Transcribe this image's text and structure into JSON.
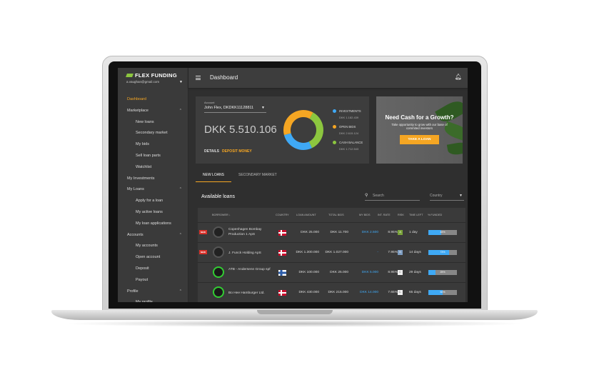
{
  "brand": "FLEX FUNDING",
  "user_email": "a.vaughan@gmail.com",
  "header": {
    "title": "Dashboard"
  },
  "sidebar": [
    {
      "label": "Dashboard",
      "level": 0,
      "active": true
    },
    {
      "label": "Marketplace",
      "level": 0,
      "expandable": true
    },
    {
      "label": "New loans",
      "level": 1
    },
    {
      "label": "Secondary market",
      "level": 1
    },
    {
      "label": "My bids",
      "level": 1
    },
    {
      "label": "Sell loan parts",
      "level": 1
    },
    {
      "label": "Watchlist",
      "level": 1
    },
    {
      "label": "My Investments",
      "level": 0
    },
    {
      "label": "My Loans",
      "level": 0,
      "expandable": true
    },
    {
      "label": "Apply for a loan",
      "level": 1
    },
    {
      "label": "My active loans",
      "level": 1
    },
    {
      "label": "My loan applications",
      "level": 1
    },
    {
      "label": "Accounts",
      "level": 0,
      "expandable": true
    },
    {
      "label": "My accounts",
      "level": 1
    },
    {
      "label": "Open account",
      "level": 1
    },
    {
      "label": "Deposit",
      "level": 1
    },
    {
      "label": "Payout",
      "level": 1
    },
    {
      "label": "Profile",
      "level": 0,
      "expandable": true
    },
    {
      "label": "My profile",
      "level": 1
    }
  ],
  "account": {
    "label": "Account",
    "selected": "John Flex, DKDKK11128811",
    "balance": "DKK 5.510.106",
    "details": "DETAILS",
    "deposit": "DEPOSIT MONEY",
    "legend": [
      {
        "label": "INVESTMENTS",
        "value": "DKK 1.182.439",
        "color": "#3fa9f5",
        "share": 0.28
      },
      {
        "label": "OPEN BIDS",
        "value": "DKK 2.615.124",
        "color": "#f5a623",
        "share": 0.37
      },
      {
        "label": "CASH BALANCE",
        "value": "DKK 1.712.543",
        "color": "#8cc63f",
        "share": 0.35
      }
    ]
  },
  "promo": {
    "title": "Need Cash for a Growth?",
    "text": "Take opportunity to grow with our base of commited investors",
    "button": "TAKE A LOAN"
  },
  "tabs": [
    {
      "label": "NEW LOANS",
      "active": true
    },
    {
      "label": "SECONDARY MARKET"
    }
  ],
  "loans": {
    "title": "Available loans",
    "search_placeholder": "Search",
    "country_placeholder": "Country",
    "columns": [
      "BORROWER ↓",
      "COUNTRY",
      "LOAN AMOUNT",
      "TOTAL BIDS",
      "MY BIDS",
      "INT. RATE",
      "RISK",
      "TIME LEFT",
      "% FUNDED"
    ],
    "rows": [
      {
        "new": "NEW",
        "name": "Copenhagen Bombay Production 1 ApS",
        "country": "DK",
        "amount": "DKK 25.000",
        "total": "DKK 11.700",
        "mybids": "DKK 2.500",
        "rate": "8.95%",
        "risk": "A",
        "risk_color": "#7aa33a",
        "time": "1 day",
        "funded": 45,
        "funded_label": "45%"
      },
      {
        "new": "NEW",
        "name": "J. Funck Holding ApS",
        "country": "DK",
        "amount": "DKK 1.300.000",
        "total": "DKK 1.027.000",
        "mybids": "-",
        "rate": "7.95%",
        "risk": "B",
        "risk_color": "#7d9cc0",
        "time": "14 days",
        "funded": 73,
        "funded_label": "73%"
      },
      {
        "new": "",
        "name": "ATB - Andersenn Group spf",
        "country": "FO",
        "amount": "DKK 100.000",
        "total": "DKK 25.000",
        "mybids": "DKK 5.000",
        "rate": "8.95%",
        "risk": "C",
        "risk_color": "#eeeeee",
        "time": "29 days",
        "funded": 25,
        "funded_label": "25%"
      },
      {
        "new": "",
        "name": "Bo Hee Hamburger Ltd.",
        "country": "DK",
        "amount": "DKK 430.000",
        "total": "DKK 215.000",
        "mybids": "DKK 14.000",
        "rate": "7.65%",
        "risk": "C-",
        "risk_color": "#eeeeee",
        "time": "65 days",
        "funded": 50,
        "funded_label": "50%"
      }
    ]
  }
}
